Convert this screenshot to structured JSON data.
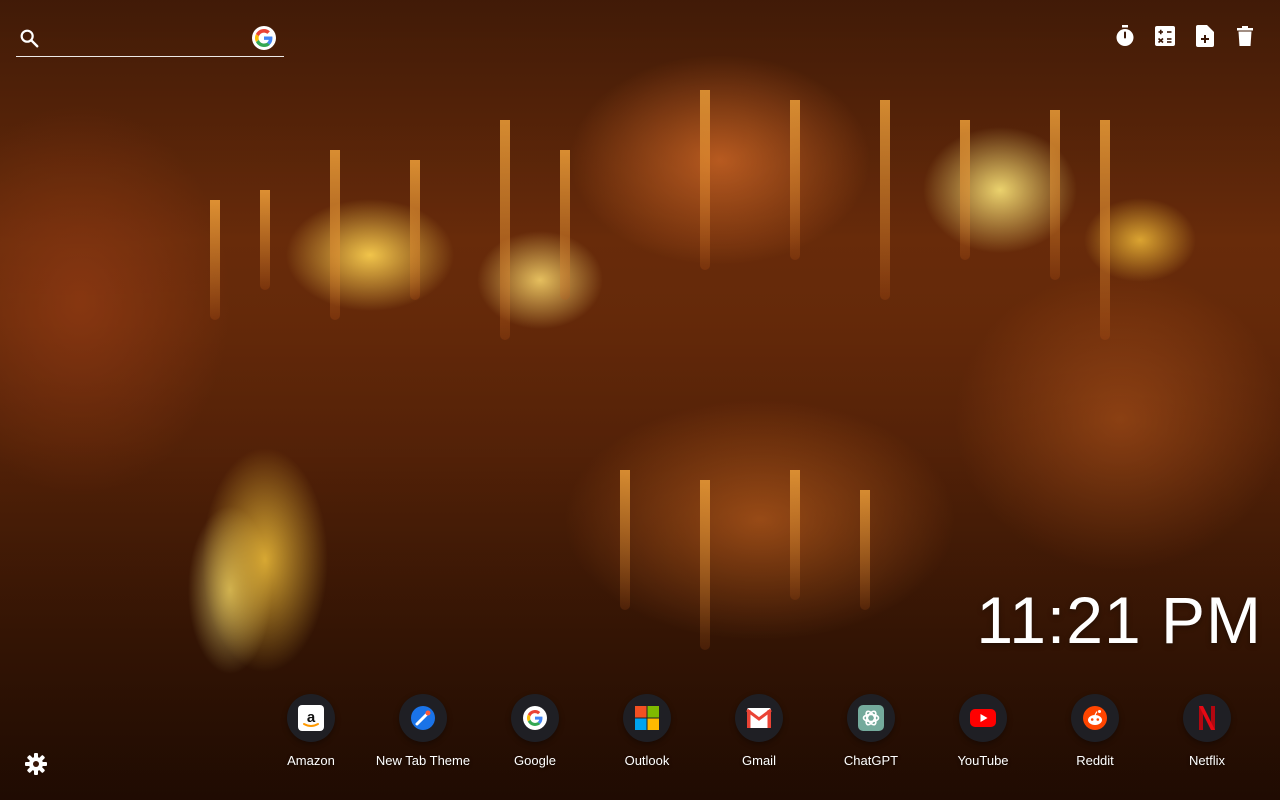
{
  "search": {
    "placeholder": "",
    "value": "",
    "icon": "search-icon",
    "engine_icon": "google-g-icon"
  },
  "toolbar": {
    "items": [
      {
        "icon": "timer-icon"
      },
      {
        "icon": "calculator-icon"
      },
      {
        "icon": "new-note-icon"
      },
      {
        "icon": "trash-icon"
      }
    ]
  },
  "clock": {
    "time": "11:21 PM"
  },
  "shortcuts": [
    {
      "label": "Amazon",
      "icon": "amazon-icon"
    },
    {
      "label": "New Tab Theme",
      "icon": "new-tab-theme-icon"
    },
    {
      "label": "Google",
      "icon": "google-icon"
    },
    {
      "label": "Outlook",
      "icon": "microsoft-icon"
    },
    {
      "label": "Gmail",
      "icon": "gmail-icon"
    },
    {
      "label": "ChatGPT",
      "icon": "chatgpt-icon"
    },
    {
      "label": "YouTube",
      "icon": "youtube-icon"
    },
    {
      "label": "Reddit",
      "icon": "reddit-icon"
    },
    {
      "label": "Netflix",
      "icon": "netflix-icon"
    }
  ],
  "settings": {
    "icon": "gear-icon"
  },
  "colors": {
    "tile_bg": "#1f1f24",
    "youtube_red": "#ff0000",
    "reddit_orange": "#ff4500",
    "netflix_red": "#e50914",
    "gmail_red": "#ea4335"
  }
}
